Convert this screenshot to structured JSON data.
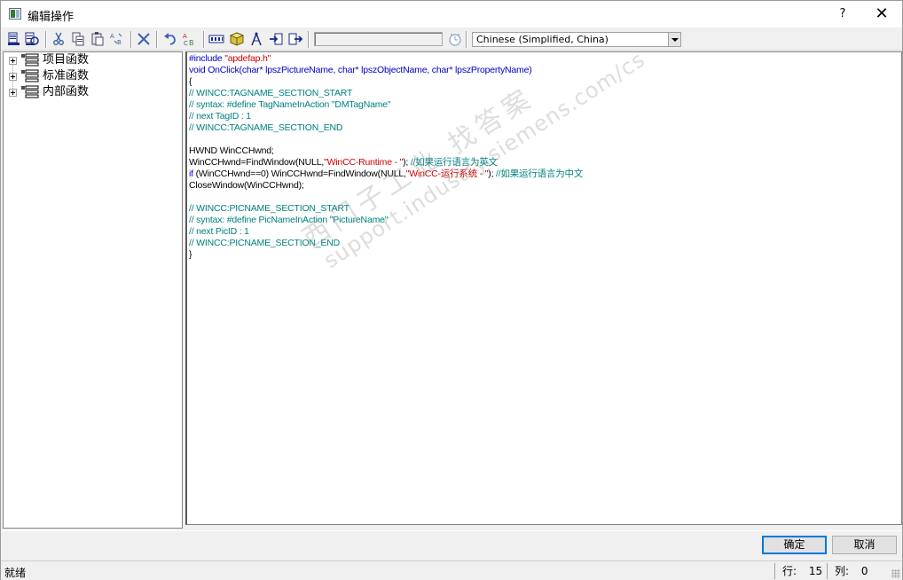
{
  "window": {
    "title": "编辑操作",
    "help_label": "?",
    "close_label": "✕"
  },
  "toolbar": {
    "icons": [
      "compile-icon",
      "compile-all-icon",
      "cut-icon",
      "copy-icon",
      "paste-icon",
      "replace-icon",
      "delete-icon",
      "undo-icon",
      "spell-icon",
      "tag-icon",
      "cube-icon",
      "compass-icon",
      "import-icon",
      "export-icon",
      "clock-icon"
    ],
    "language": "Chinese (Simplified, China)"
  },
  "tree": {
    "items": [
      {
        "label": "项目函数"
      },
      {
        "label": "标准函数"
      },
      {
        "label": "内部函数"
      }
    ]
  },
  "code": {
    "lines": [
      [
        {
          "t": "#include ",
          "c": "blue"
        },
        {
          "t": "\"apdefap.h\"",
          "c": "red"
        }
      ],
      [
        {
          "t": "void ",
          "c": "blue"
        },
        {
          "t": "OnClick(",
          "c": "blue"
        },
        {
          "t": "char",
          "c": "blue"
        },
        {
          "t": "* lpszPictureName, ",
          "c": "blue"
        },
        {
          "t": "char",
          "c": "blue"
        },
        {
          "t": "* lpszObjectName, ",
          "c": "blue"
        },
        {
          "t": "char",
          "c": "blue"
        },
        {
          "t": "* lpszPropertyName)",
          "c": "blue"
        }
      ],
      [
        {
          "t": "{",
          "c": "black"
        }
      ],
      [
        {
          "t": "// WINCC:TAGNAME_SECTION_START",
          "c": "green"
        }
      ],
      [
        {
          "t": "// syntax: #define TagNameInAction \"DMTagName\"",
          "c": "green"
        }
      ],
      [
        {
          "t": "// next TagID : 1",
          "c": "green"
        }
      ],
      [
        {
          "t": "// WINCC:TAGNAME_SECTION_END",
          "c": "green"
        }
      ],
      [
        {
          "t": "",
          "c": "black"
        }
      ],
      [
        {
          "t": "HWND WinCCHwnd;",
          "c": "black"
        }
      ],
      [
        {
          "t": "WinCCHwnd=FindWindow(NULL,",
          "c": "black"
        },
        {
          "t": "\"WinCC-Runtime - \"",
          "c": "red"
        },
        {
          "t": "); ",
          "c": "black"
        },
        {
          "t": "//如果运行语言为英文",
          "c": "green"
        }
      ],
      [
        {
          "t": "if ",
          "c": "blue"
        },
        {
          "t": "(WinCCHwnd==0) WinCCHwnd=FindWindow(NULL,",
          "c": "black"
        },
        {
          "t": "\"WinCC-运行系统 - \"",
          "c": "red"
        },
        {
          "t": "); ",
          "c": "black"
        },
        {
          "t": "//如果运行语言为中文",
          "c": "green"
        }
      ],
      [
        {
          "t": "CloseWindow(WinCCHwnd);",
          "c": "black"
        }
      ],
      [
        {
          "t": "",
          "c": "black"
        }
      ],
      [
        {
          "t": "// WINCC:PICNAME_SECTION_START",
          "c": "green"
        }
      ],
      [
        {
          "t": "// syntax: #define PicNameInAction \"PictureName\"",
          "c": "green"
        }
      ],
      [
        {
          "t": "// next PicID : 1",
          "c": "green"
        }
      ],
      [
        {
          "t": "// WINCC:PICNAME_SECTION_END",
          "c": "green"
        }
      ],
      [
        {
          "t": "}",
          "c": "black"
        }
      ]
    ]
  },
  "watermark": {
    "line1": "西门子工业  找答案",
    "line2": "support.industry.siemens.com/cs"
  },
  "buttons": {
    "ok": "确定",
    "cancel": "取消"
  },
  "status": {
    "text": "就绪",
    "row_label": "行:",
    "row_value": "15",
    "col_label": "列:",
    "col_value": "0"
  }
}
